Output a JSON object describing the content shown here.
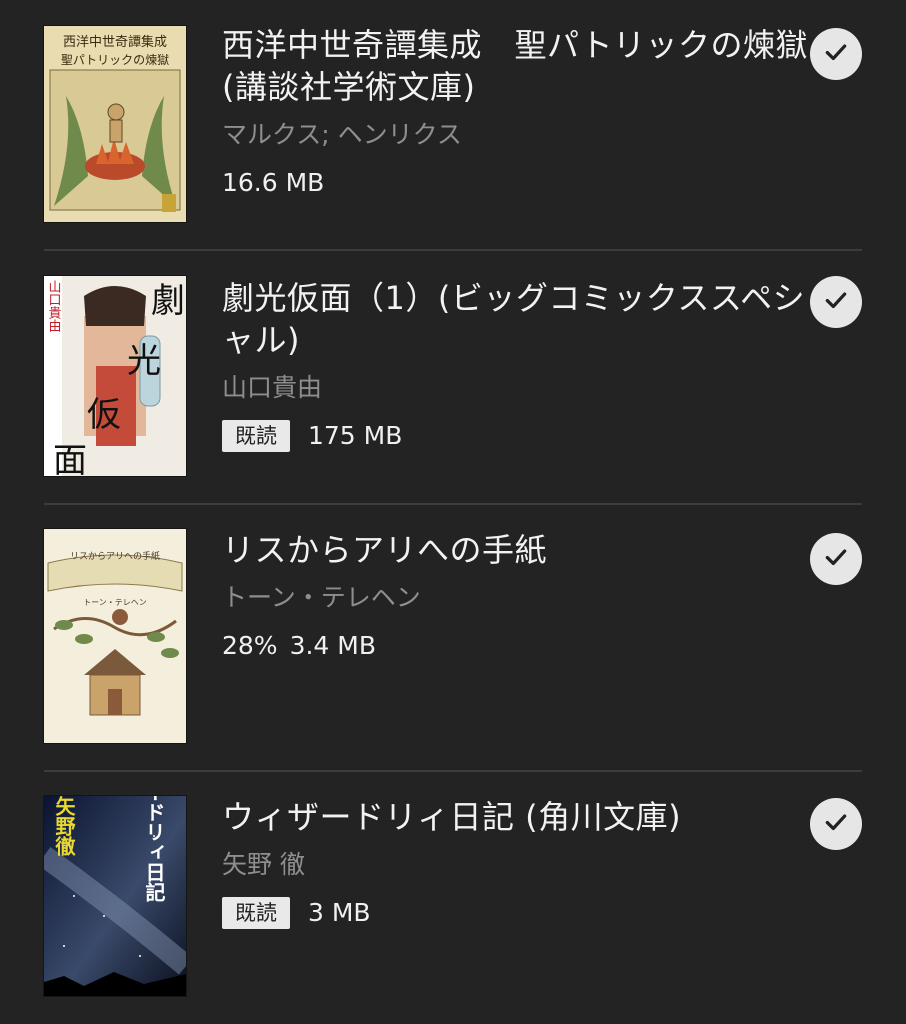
{
  "books": [
    {
      "title": "西洋中世奇譚集成　聖パトリックの煉獄 (講談社学術文庫)",
      "author": "マルクス; ヘンリクス",
      "badge": "",
      "progress": "",
      "size": "16.6 MB",
      "selected": true,
      "cover": {
        "line1": "西洋中世奇譚集成",
        "line2": "聖パトリックの煉獄"
      }
    },
    {
      "title": "劇光仮面（1）(ビッグコミックススペシャル)",
      "author": "山口貴由",
      "badge": "既読",
      "progress": "",
      "size": "175 MB",
      "selected": true,
      "cover": {
        "title_chars": [
          "劇",
          "光",
          "仮",
          "面"
        ],
        "side": "山口貴由"
      }
    },
    {
      "title": "リスからアリへの手紙",
      "author": "トーン・テレヘン",
      "badge": "",
      "progress": "28%",
      "size": "3.4 MB",
      "selected": true,
      "cover": {
        "title": "リスからアリへの手紙",
        "author": "トーン・テレヘン"
      }
    },
    {
      "title": "ウィザードリィ日記 (角川文庫)",
      "author": "矢野 徹",
      "badge": "既読",
      "progress": "",
      "size": "3 MB",
      "selected": true,
      "cover": {
        "title": "ウィザードリィ日記",
        "author": "矢野徹"
      }
    }
  ],
  "colors": {
    "background": "#232323",
    "title": "#f2f2f2",
    "author": "#8e8e8e",
    "badge_bg": "#e9e9e9",
    "check_bg": "#e6e6e6"
  },
  "icons": {
    "selected": "check-circle-icon"
  }
}
